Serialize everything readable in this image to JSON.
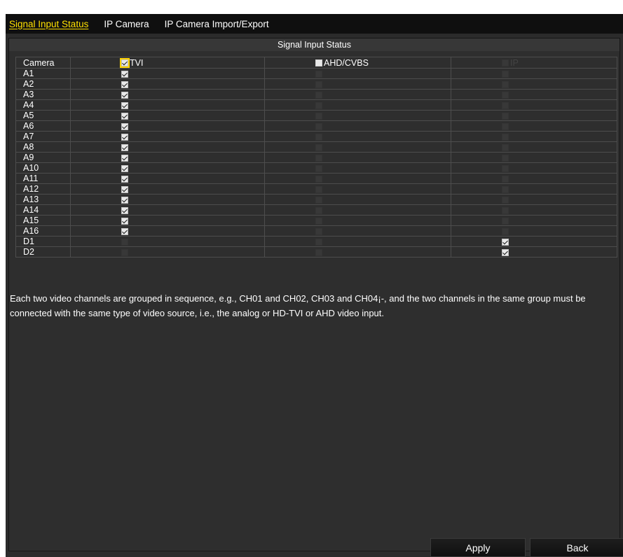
{
  "tabs": [
    {
      "label": "Signal Input Status",
      "active": true
    },
    {
      "label": "IP Camera",
      "active": false
    },
    {
      "label": "IP Camera Import/Export",
      "active": false
    }
  ],
  "panel": {
    "title": "Signal Input Status"
  },
  "columns": {
    "camera": "Camera",
    "tvi": "TVI",
    "ahd": "AHD/CVBS",
    "ip": "IP"
  },
  "header_checks": {
    "tvi": true,
    "ahd": false,
    "ip": false
  },
  "rows": [
    {
      "camera": "A1",
      "tvi": true,
      "ahd": false,
      "ip": false
    },
    {
      "camera": "A2",
      "tvi": true,
      "ahd": false,
      "ip": false
    },
    {
      "camera": "A3",
      "tvi": true,
      "ahd": false,
      "ip": false
    },
    {
      "camera": "A4",
      "tvi": true,
      "ahd": false,
      "ip": false
    },
    {
      "camera": "A5",
      "tvi": true,
      "ahd": false,
      "ip": false
    },
    {
      "camera": "A6",
      "tvi": true,
      "ahd": false,
      "ip": false
    },
    {
      "camera": "A7",
      "tvi": true,
      "ahd": false,
      "ip": false
    },
    {
      "camera": "A8",
      "tvi": true,
      "ahd": false,
      "ip": false
    },
    {
      "camera": "A9",
      "tvi": true,
      "ahd": false,
      "ip": false
    },
    {
      "camera": "A10",
      "tvi": true,
      "ahd": false,
      "ip": false
    },
    {
      "camera": "A11",
      "tvi": true,
      "ahd": false,
      "ip": false
    },
    {
      "camera": "A12",
      "tvi": true,
      "ahd": false,
      "ip": false
    },
    {
      "camera": "A13",
      "tvi": true,
      "ahd": false,
      "ip": false
    },
    {
      "camera": "A14",
      "tvi": true,
      "ahd": false,
      "ip": false
    },
    {
      "camera": "A15",
      "tvi": true,
      "ahd": false,
      "ip": false
    },
    {
      "camera": "A16",
      "tvi": true,
      "ahd": false,
      "ip": false
    },
    {
      "camera": "D1",
      "tvi": false,
      "ahd": false,
      "ip": true
    },
    {
      "camera": "D2",
      "tvi": false,
      "ahd": false,
      "ip": true
    }
  ],
  "note": "Each two video channels are grouped in sequence, e.g., CH01 and CH02, CH03 and CH04¡-, and the two channels in the same group must be connected with the same type of video source, i.e., the analog or HD-TVI or AHD video input.",
  "buttons": {
    "apply": "Apply",
    "back": "Back"
  },
  "colors": {
    "active_tab": "#ffe000",
    "background": "#2b2b2b",
    "tabbar": "#0f0f0f"
  }
}
